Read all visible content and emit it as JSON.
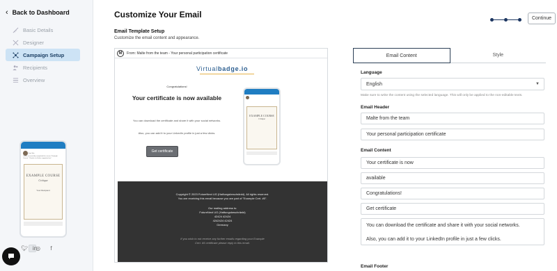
{
  "sidebar": {
    "back_label": "Back to Dashboard",
    "items": [
      {
        "label": "Basic Details",
        "icon": "ruler-icon"
      },
      {
        "label": "Designer",
        "icon": "tools-icon"
      },
      {
        "label": "Campaign Setup",
        "icon": "network-icon",
        "active": true
      },
      {
        "label": "Recipients",
        "icon": "users-icon"
      },
      {
        "label": "Overview",
        "icon": "list-icon"
      }
    ],
    "phone_preview": {
      "poster_name": "Suzi Sho",
      "post_text": "I have successfully completed the course \"Example Course\". Thanks to all who supported me!",
      "cert_title": "EXAMPLE COURSE",
      "cert_subtitle": "Critique",
      "cert_recipient": "Your Recipient"
    },
    "social_icons": [
      "linkedin-icon",
      "twitter-icon",
      "instagram-icon",
      "facebook-icon"
    ]
  },
  "header": {
    "title": "Customize Your Email",
    "continue_label": "Continue",
    "steps_total": 3,
    "steps_current": 3
  },
  "section": {
    "title": "Email Template Setup",
    "subtitle": "Customize the email content and appearance."
  },
  "preview": {
    "from_line": "From: Malte from the team - Your personal participation certificate",
    "avatar_letter": "M",
    "logo_text_a": "Virtual",
    "logo_text_b": "badge.io",
    "congrats": "Congratulations!",
    "headline": "Your certificate is now available",
    "para1": "You can download the certificate and share it with your social networks.",
    "para2": "Also, you can add it to your LinkedIn profile in just a few clicks.",
    "button_label": "Get certificate",
    "phone_cert_title": "EXAMPLE COURSE",
    "phone_cert_sub": "Critique",
    "footer": {
      "copyright": "Copyright © 2023 FutureNext UG (Haftungsbeschränkt). All rights reserved.",
      "reason": "You are receiving this email because you are part of \"Example Cert. #5\".",
      "mailing_title": "Our mailing address is:",
      "addr1": "FutureNext UG (Haftungsbeschränkt)",
      "addr2": "42424 42424",
      "addr3": "4242424 42424",
      "addr4": "Germany",
      "note": "If you wish to not receive any further emails regarding your Example Cert. #5 certificate please reply to this email."
    }
  },
  "panel": {
    "tabs": [
      "Email Content",
      "Style"
    ],
    "language_label": "Language",
    "language_value": "English",
    "language_hint": "Make sure to write the content using the selected language. This will only be applied to the non-editable texts.",
    "header_label": "Email Header",
    "header_fields": [
      "Malte from the team",
      "Your personal participation certificate"
    ],
    "content_label": "Email Content",
    "content_fields": [
      "Your certificate is now",
      "available",
      "Congratulations!",
      "Get certificate"
    ],
    "content_textarea": [
      "You can download the certificate and share it with your social networks.",
      "Also, you can add it to your LinkedIn profile in just a few clicks."
    ],
    "footer_label": "Email Footer"
  }
}
